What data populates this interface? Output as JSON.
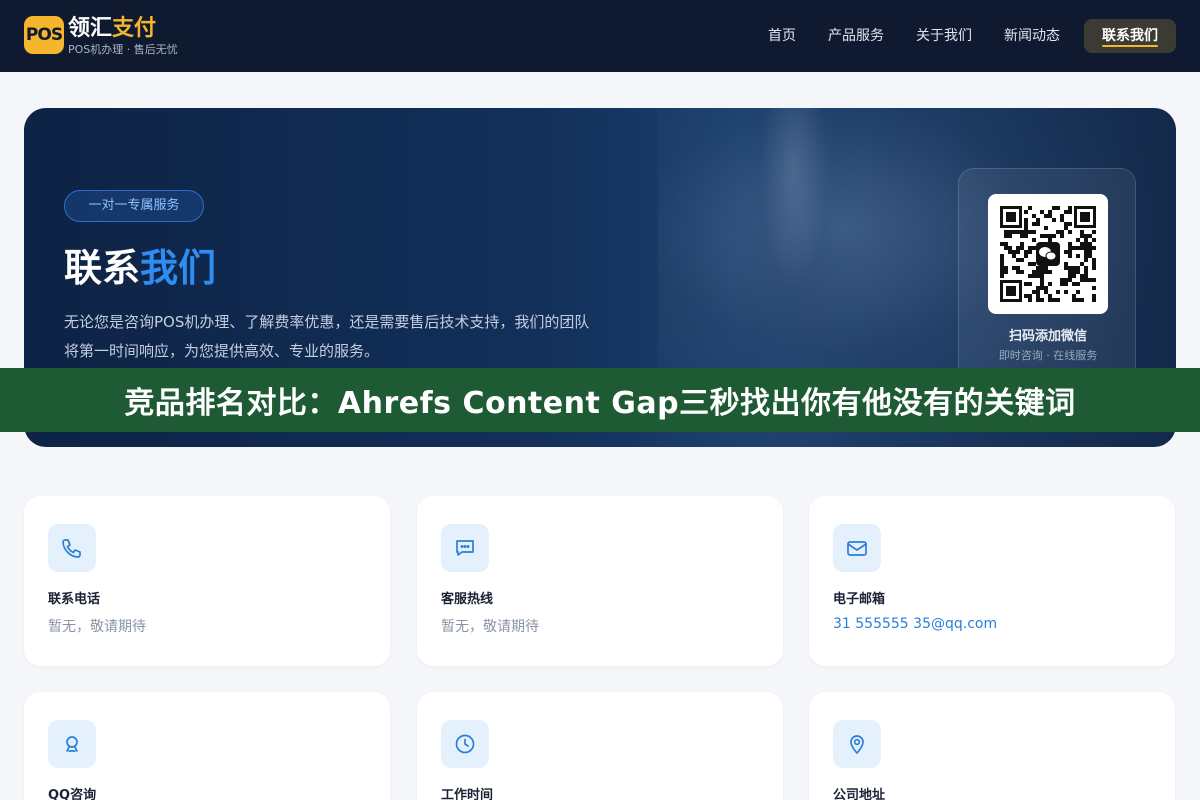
{
  "header": {
    "logo_badge": "POS",
    "logo_title_main": "领汇",
    "logo_title_accent": "支付",
    "logo_subtitle": "POS机办理 · 售后无忧",
    "nav": [
      {
        "label": "首页"
      },
      {
        "label": "产品服务"
      },
      {
        "label": "关于我们"
      },
      {
        "label": "新闻动态"
      },
      {
        "label": "联系我们",
        "active": true
      }
    ]
  },
  "hero": {
    "badge": "一对一专属服务",
    "title_main": "联系",
    "title_accent": "我们",
    "description": "无论您是咨询POS机办理、了解费率优惠，还是需要售后技术支持，我们的团队将第一时间响应，为您提供高效、专业的服务。",
    "qr": {
      "label": "扫码添加微信",
      "sub": "即时咨询 · 在线服务",
      "icon": "wechat-icon"
    }
  },
  "overlay_banner": "竞品排名对比：Ahrefs Content Gap三秒找出你有他没有的关键词",
  "contact_cards": [
    {
      "icon": "phone-icon",
      "title": "联系电话",
      "value": "暂无，敬请期待"
    },
    {
      "icon": "chat-icon",
      "title": "客服热线",
      "value": "暂无，敬请期待"
    },
    {
      "icon": "mail-icon",
      "title": "电子邮箱",
      "value": "31 555555 35@qq.com"
    },
    {
      "icon": "qq-icon",
      "title": "QQ咨询",
      "value": ""
    },
    {
      "icon": "clock-icon",
      "title": "工作时间",
      "value": ""
    },
    {
      "icon": "location-icon",
      "title": "公司地址",
      "value": ""
    }
  ],
  "colors": {
    "header_bg": "#0f1a30",
    "brand_yellow": "#f5b52c",
    "accent_blue": "#2f8cf0",
    "banner_green": "#1e5a34",
    "icon_tint": "#2b7fd6"
  }
}
